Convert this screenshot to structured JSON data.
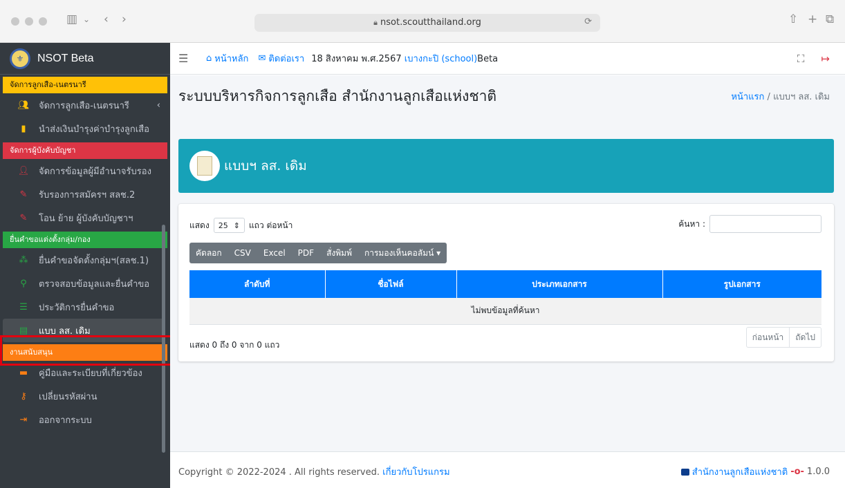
{
  "browser": {
    "url": "nsot.scoutthailand.org"
  },
  "sidebar": {
    "brand": "NSOT Beta",
    "sections": [
      {
        "label": "จัดการลูกเสือ-เนตรนารี",
        "color": "#ffc107"
      },
      {
        "label": "จัดการผู้บังคับบัญชา",
        "color": "#dc3545"
      },
      {
        "label": "ยื่นคำขอแต่งตั้งกลุ่ม/กอง",
        "color": "#28a745"
      },
      {
        "label": "งานสนับสนุน",
        "color": "#fd7e14"
      }
    ],
    "items": [
      {
        "label": "จัดการลูกเสือ-เนตรนารี",
        "icon": "users-icon",
        "color": "#ffc107"
      },
      {
        "label": "นำส่งเงินบำรุงค่าบำรุงลูกเสือ",
        "icon": "file-icon",
        "color": "#ffc107"
      },
      {
        "label": "จัดการข้อมูลผู้มีอำนาจรับรอง",
        "icon": "user-edit-icon",
        "color": "#dc3545"
      },
      {
        "label": "รับรองการสมัครฯ สลช.2",
        "icon": "edit-icon",
        "color": "#dc3545"
      },
      {
        "label": "โอน ย้าย ผู้บังคับบัญชาฯ",
        "icon": "edit-icon",
        "color": "#dc3545"
      },
      {
        "label": "ยื่นคำขอจัดตั้งกลุ่มฯ(สลช.1)",
        "icon": "sitemap-icon",
        "color": "#28a745"
      },
      {
        "label": "ตรวจสอบข้อมูลและยื่นคำขอ",
        "icon": "search-icon",
        "color": "#28a745"
      },
      {
        "label": "ประวัติการยื่นคำขอ",
        "icon": "list-icon",
        "color": "#28a745"
      },
      {
        "label": "แบบ ลส. เดิม",
        "icon": "file-icon",
        "color": "#28a745"
      },
      {
        "label": "คู่มือและระเบียบที่เกี่ยวข้อง",
        "icon": "book-icon",
        "color": "#fd7e14"
      },
      {
        "label": "เปลี่ยนรหัสผ่าน",
        "icon": "key-icon",
        "color": "#fd7e14"
      },
      {
        "label": "ออกจากระบบ",
        "icon": "sign-out-icon",
        "color": "#fd7e14"
      }
    ]
  },
  "navbar": {
    "home": "หน้าหลัก",
    "contact": "ติดต่อเรา",
    "date": "18 สิงหาคม พ.ศ.2567",
    "school": "เบางกะปิ (school)",
    "school_suffix": "Beta"
  },
  "page": {
    "title": "ระบบบริหารกิจการลูกเสือ สำนักงานลูกเสือแห่งชาติ",
    "breadcrumb_home": "หน้าแรก",
    "breadcrumb_current": "แบบฯ ลส. เดิม",
    "banner_title": "แบบฯ ลส. เดิม"
  },
  "table": {
    "show_label": "แสดง",
    "page_size": "25",
    "per_page_label": "แถว ต่อหน้า",
    "search_label": "ค้นหา :",
    "buttons": [
      "คัดลอก",
      "CSV",
      "Excel",
      "PDF",
      "สั่งพิมพ์",
      "การมองเห็นคอลัมน์"
    ],
    "columns": [
      "ลำดับที่",
      "ชื่อไฟล์",
      "ประเภทเอกสาร",
      "รูปเอกสาร"
    ],
    "empty": "ไม่พบข้อมูลที่ค้นหา",
    "info": "แสดง 0 ถึง 0 จาก 0 แถว",
    "prev": "ก่อนหน้า",
    "next": "ถัดไป"
  },
  "footer": {
    "copyright": "Copyright © 2022-2024 . All rights reserved.",
    "about": "เกี่ยวกับโปรแกรม",
    "org": "สำนักงานลูกเสือแห่งชาติ",
    "version": "1.0.0"
  }
}
